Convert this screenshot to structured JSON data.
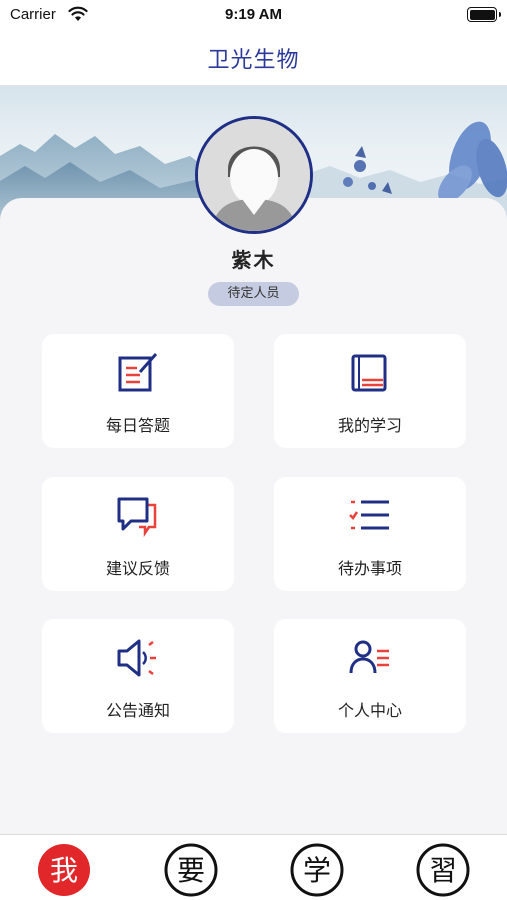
{
  "status_bar": {
    "carrier": "Carrier",
    "time": "9:19 AM"
  },
  "nav": {
    "title": "卫光生物"
  },
  "profile": {
    "name": "紫木",
    "role": "待定人员"
  },
  "menu": [
    {
      "label": "每日答题",
      "icon": "quiz-edit-icon"
    },
    {
      "label": "我的学习",
      "icon": "book-icon"
    },
    {
      "label": "建议反馈",
      "icon": "feedback-chat-icon"
    },
    {
      "label": "待办事项",
      "icon": "todo-list-icon"
    },
    {
      "label": "公告通知",
      "icon": "speaker-icon"
    },
    {
      "label": "个人中心",
      "icon": "profile-list-icon"
    }
  ],
  "tabbar": {
    "tabs": [
      {
        "glyph": "我",
        "active": true
      },
      {
        "glyph": "要",
        "active": false
      },
      {
        "glyph": "学",
        "active": false
      },
      {
        "glyph": "習",
        "active": false
      }
    ]
  },
  "colors": {
    "brand": "#1f2f86",
    "accent": "#e8423b",
    "active_tab": "#e2272b"
  }
}
